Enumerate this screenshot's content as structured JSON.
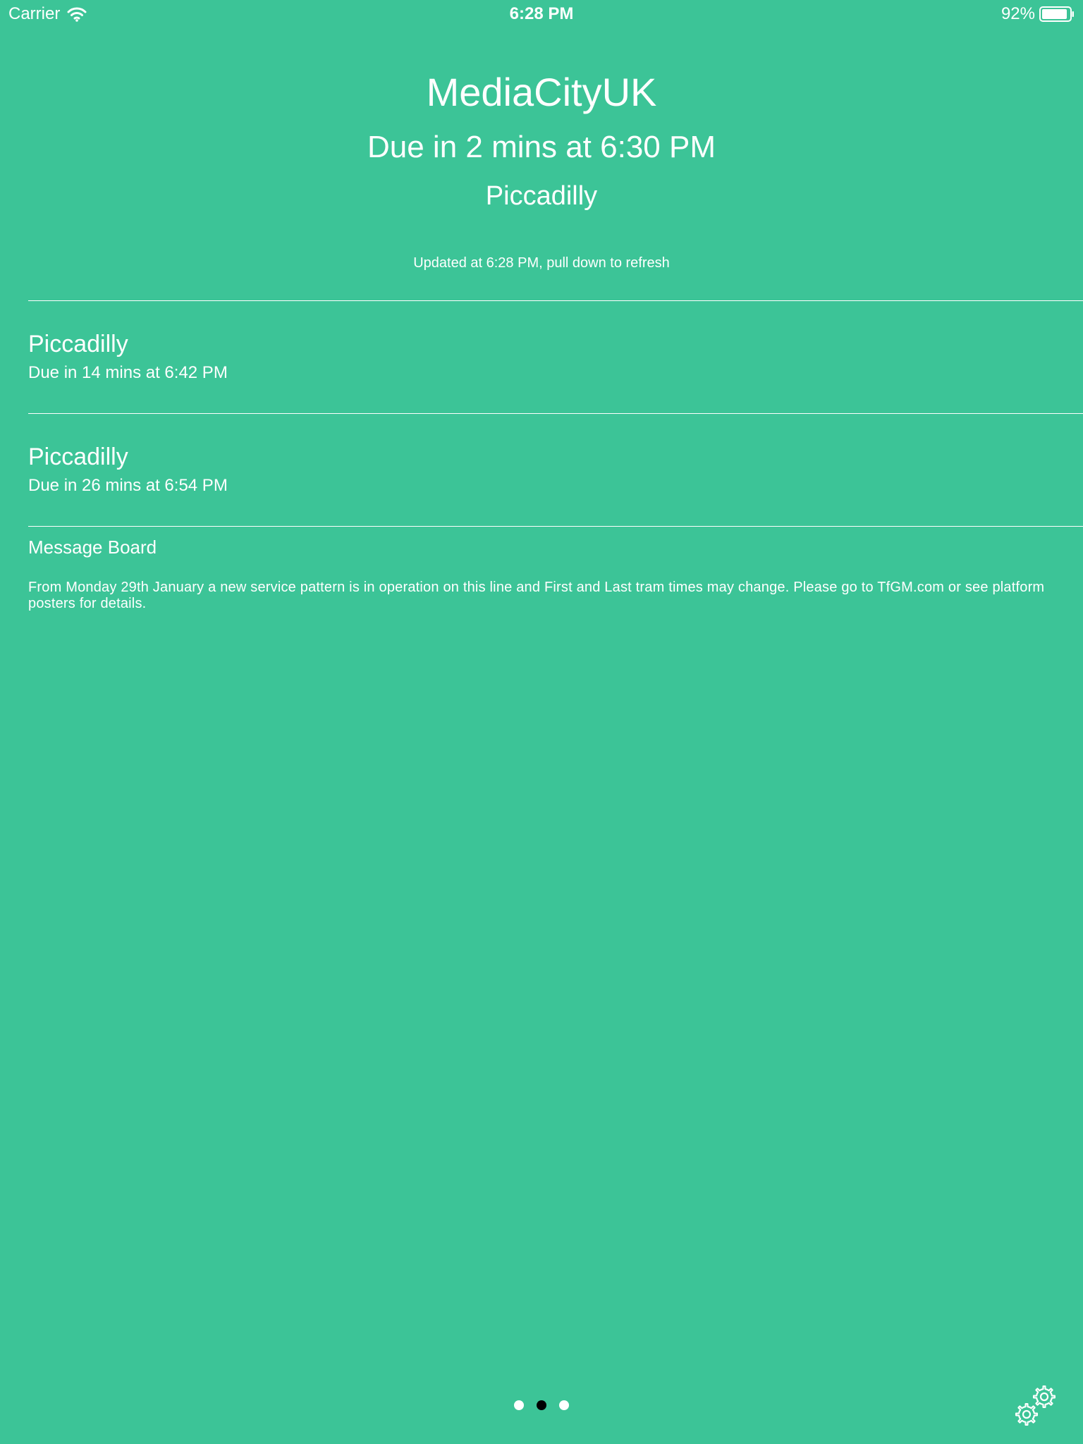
{
  "status_bar": {
    "carrier": "Carrier",
    "time": "6:28 PM",
    "battery": "92%",
    "battery_level": 0.92
  },
  "header": {
    "station": "MediaCityUK",
    "next_due": "Due in 2 mins at 6:30 PM",
    "next_destination": "Piccadilly",
    "updated": "Updated at 6:28 PM, pull down to refresh"
  },
  "departures": [
    {
      "destination": "Piccadilly",
      "due": "Due in 14 mins at 6:42 PM"
    },
    {
      "destination": "Piccadilly",
      "due": "Due in 26 mins at 6:54 PM"
    }
  ],
  "message_board": {
    "title": "Message Board",
    "body": "From Monday 29th January a new service pattern is in operation on this line and First and Last tram times may change. Please go to TfGM.com or see platform posters for details."
  },
  "pager": {
    "count": 3,
    "active_index": 1
  },
  "icons": {
    "wifi": "wifi-icon",
    "battery": "battery-icon",
    "settings": "gears-icon"
  },
  "colors": {
    "background": "#3cc497",
    "text": "#ffffff",
    "active_dot": "#000000"
  }
}
